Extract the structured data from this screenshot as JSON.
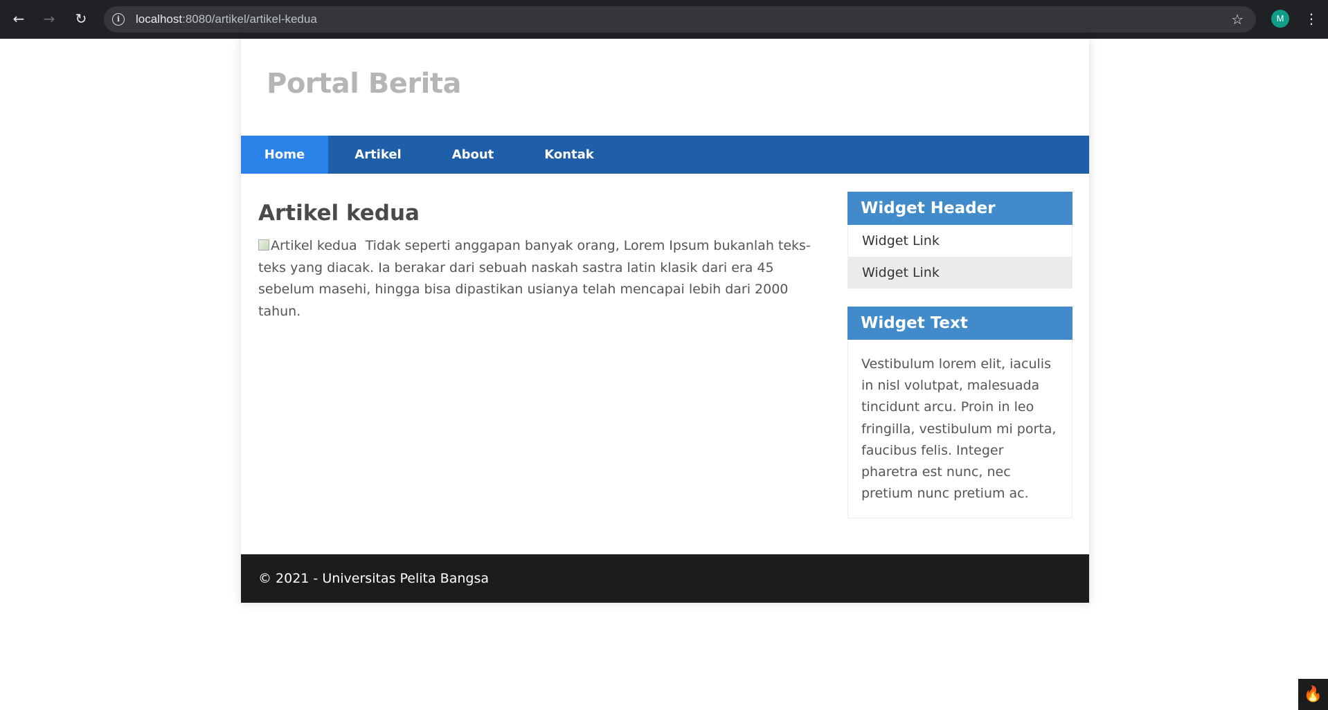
{
  "browser": {
    "back_icon": "arrow-left-icon",
    "forward_icon": "arrow-right-icon",
    "reload_icon": "reload-icon",
    "url_host": "localhost",
    "url_path": ":8080/artikel/artikel-kedua",
    "profile_initial": "M"
  },
  "site": {
    "title": "Portal Berita"
  },
  "nav": {
    "items": [
      {
        "label": "Home"
      },
      {
        "label": "Artikel"
      },
      {
        "label": "About"
      },
      {
        "label": "Kontak"
      }
    ],
    "active": "Home",
    "bar_color": "#1f5faa",
    "active_color": "#2b83ea"
  },
  "article": {
    "title": "Artikel kedua",
    "image_alt": "Artikel kedua",
    "body": "Tidak seperti anggapan banyak orang, Lorem Ipsum bukanlah teks-teks yang diacak. Ia berakar dari sebuah naskah sastra latin klasik dari era 45 sebelum masehi, hingga bisa dipastikan usianya telah mencapai lebih dari 2000 tahun."
  },
  "sidebar": {
    "widget1": {
      "header": "Widget Header",
      "links": [
        "Widget Link",
        "Widget Link"
      ]
    },
    "widget2": {
      "header": "Widget Text",
      "text": "Vestibulum lorem elit, iaculis in nisl volutpat, malesuada tincidunt arcu. Proin in leo fringilla, vestibulum mi porta, faucibus felis. Integer pharetra est nunc, nec pretium nunc pretium ac."
    },
    "header_color": "#428bca"
  },
  "footer": {
    "text": "© 2021 - Universitas Pelita Bangsa"
  }
}
